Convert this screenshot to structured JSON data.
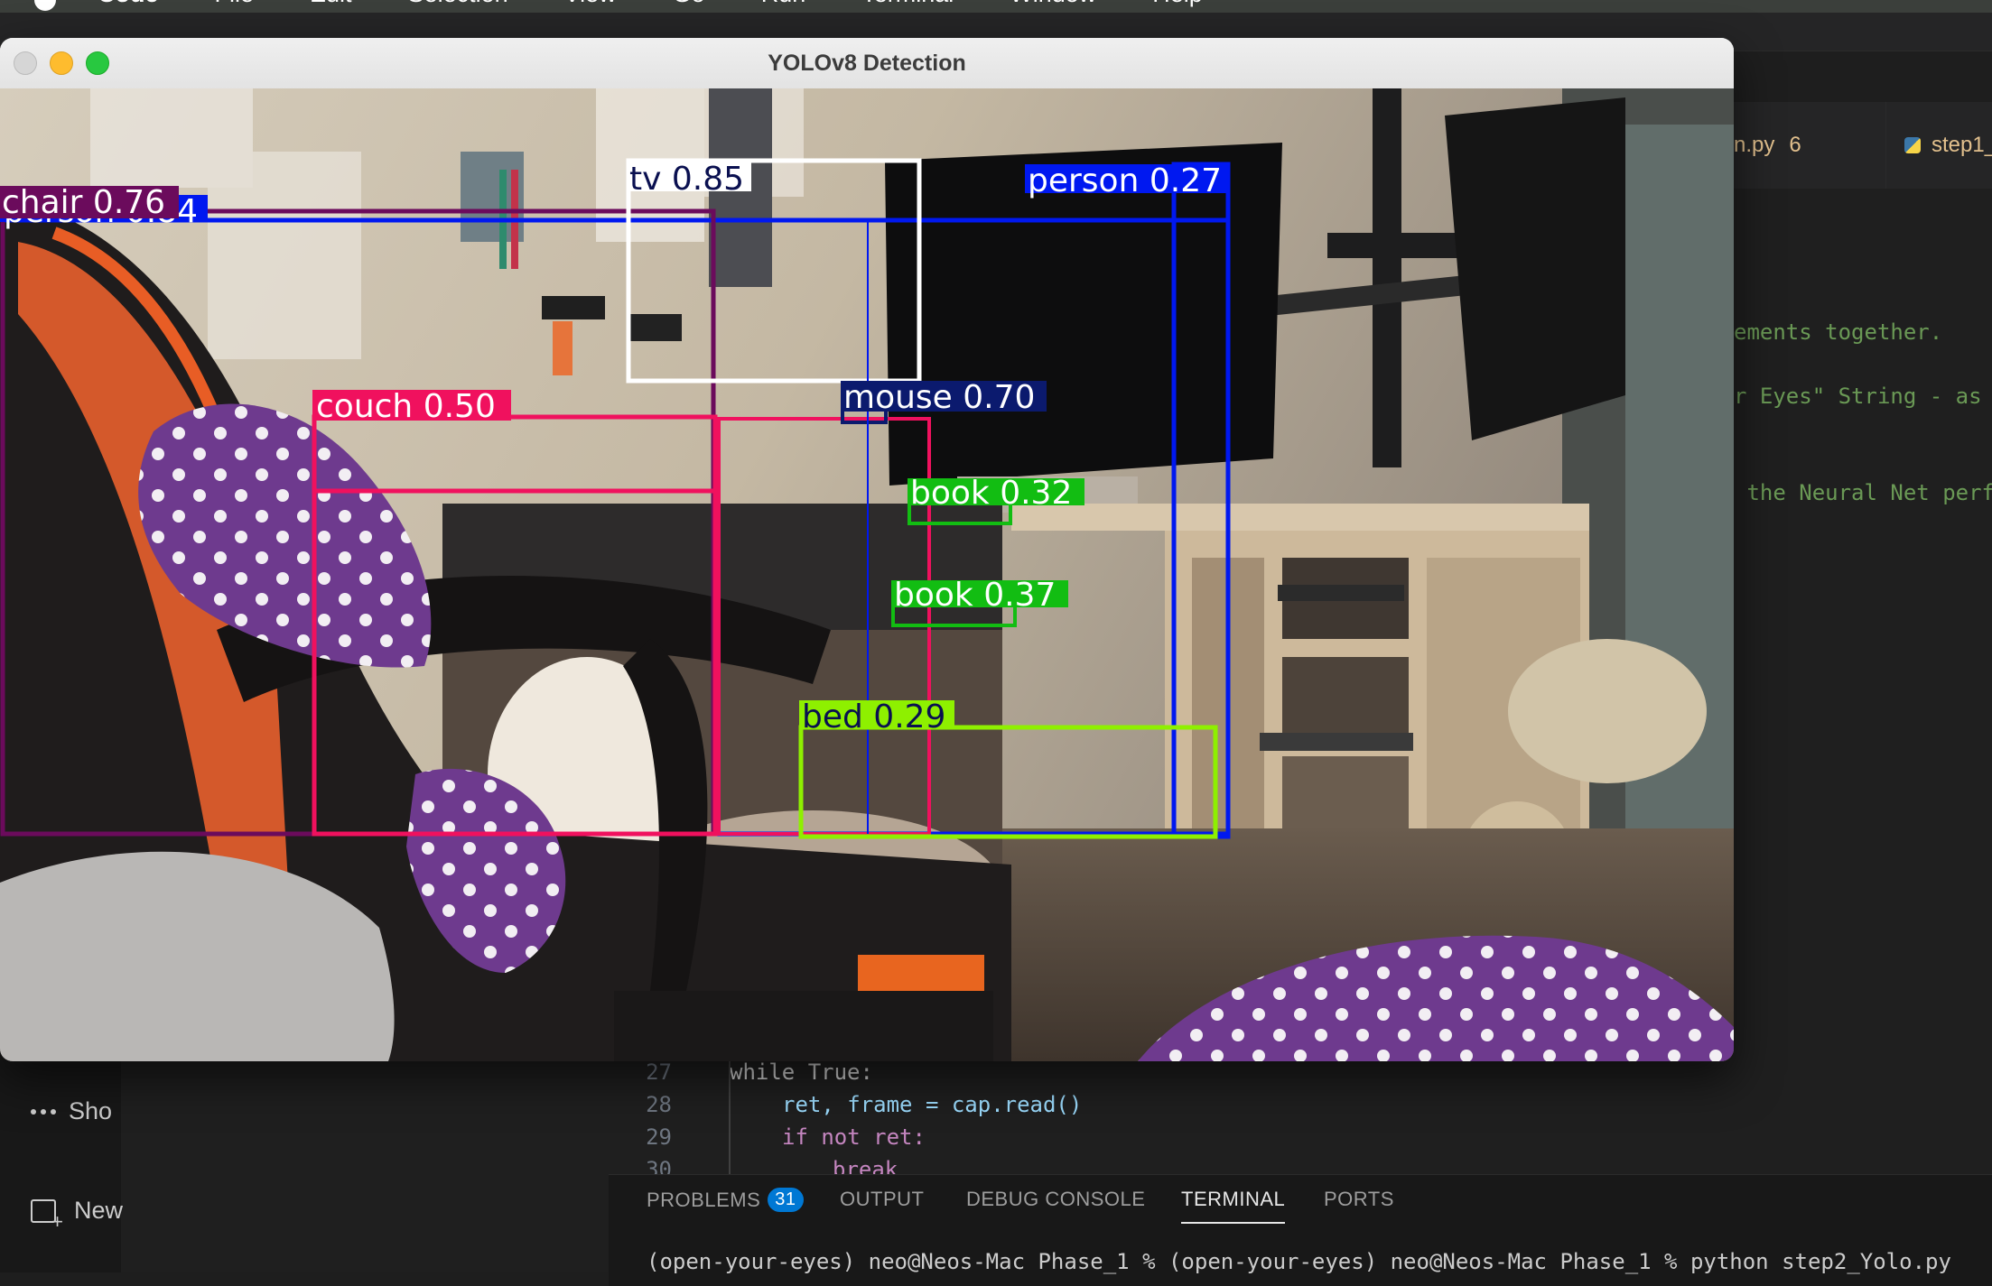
{
  "menubar": {
    "items": [
      "Code",
      "File",
      "Edit",
      "Selection",
      "View",
      "Go",
      "Run",
      "Terminal",
      "Window",
      "Help"
    ]
  },
  "vscode": {
    "tabs": [
      {
        "label": "n.py",
        "badge": "6"
      },
      {
        "label": "step1_"
      }
    ],
    "sidebar": {
      "show_more": "Sho",
      "new_item": "New"
    },
    "editor_fragments": [
      "ements together.",
      "r Eyes\" String - as",
      " the Neural Net perf"
    ],
    "code_lines": [
      {
        "num": "27",
        "text": "while True:"
      },
      {
        "num": "28",
        "text": "ret, frame = cap.read()"
      },
      {
        "num": "29",
        "text": "if not ret:"
      },
      {
        "num": "30",
        "text": "break"
      }
    ],
    "panel": {
      "tabs": [
        "PROBLEMS",
        "OUTPUT",
        "DEBUG CONSOLE",
        "TERMINAL",
        "PORTS"
      ],
      "problems_count": "31",
      "active_tab": "TERMINAL",
      "terminal_text": "(open-your-eyes) neo@Neos-Mac Phase_1 % (open-your-eyes) neo@Neos-Mac Phase_1 % python step2_Yolo.py"
    }
  },
  "detection_window": {
    "title": "YOLOv8 Detection",
    "detections": [
      {
        "label": "person 0.84",
        "color": "#0018f0"
      },
      {
        "label": "chair 0.76",
        "color": "#6b0b5c"
      },
      {
        "label": "tv 0.85",
        "color": "#ffffff",
        "text_color": "#0a1050"
      },
      {
        "label": "couch 0.50",
        "color": "#f0115e"
      },
      {
        "label": "mouse 0.70",
        "color": "#0b1a6e"
      },
      {
        "label": "person 0.27",
        "color": "#0018f0"
      },
      {
        "label": "book 0.32",
        "color": "#12bd12"
      },
      {
        "label": "book 0.37",
        "color": "#12bd12"
      },
      {
        "label": "bed 0.29",
        "color": "#8ef000",
        "text_color": "#0a1050"
      }
    ]
  }
}
